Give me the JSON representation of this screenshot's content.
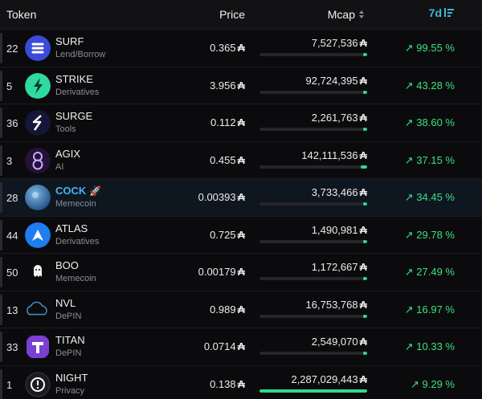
{
  "header": {
    "token": "Token",
    "price": "Price",
    "mcap": "Mcap",
    "period": "7d"
  },
  "currency_symbol": "₳",
  "rows": [
    {
      "rank": "22",
      "name": "SURF",
      "category": "Lend/Borrow",
      "price": "0.365",
      "mcap": "7,527,536",
      "mcap_fraction": 0.004,
      "change": "↗ 99.55 %",
      "logo_icon": "surf-logo-icon",
      "logo_bg": "#3a4bd8"
    },
    {
      "rank": "5",
      "name": "STRIKE",
      "category": "Derivatives",
      "price": "3.956",
      "mcap": "92,724,395",
      "mcap_fraction": 0.04,
      "change": "↗ 43.28 %",
      "logo_icon": "strike-logo-icon",
      "logo_bg": "#2fd9a0"
    },
    {
      "rank": "36",
      "name": "SURGE",
      "category": "Tools",
      "price": "0.112",
      "mcap": "2,261,763",
      "mcap_fraction": 0.001,
      "change": "↗ 38.60 %",
      "logo_icon": "surge-logo-icon",
      "logo_bg": "#1a1a3a"
    },
    {
      "rank": "3",
      "name": "AGIX",
      "category": "AI",
      "price": "0.455",
      "mcap": "142,111,536",
      "mcap_fraction": 0.062,
      "change": "↗ 37.15 %",
      "logo_icon": "agix-logo-icon",
      "logo_bg": "#2a1446"
    },
    {
      "rank": "28",
      "name": "COCK",
      "category": "Memecoin",
      "price": "0.00393",
      "mcap": "3,733,466",
      "mcap_fraction": 0.002,
      "change": "↗ 34.45 %",
      "logo_icon": "cock-logo-icon",
      "logo_bg": "#3a6fa8",
      "highlight": true
    },
    {
      "rank": "44",
      "name": "ATLAS",
      "category": "Derivatives",
      "price": "0.725",
      "mcap": "1,490,981",
      "mcap_fraction": 0.001,
      "change": "↗ 29.78 %",
      "logo_icon": "atlas-logo-icon",
      "logo_bg": "#1e7df0"
    },
    {
      "rank": "50",
      "name": "BOO",
      "category": "Memecoin",
      "price": "0.00179",
      "mcap": "1,172,667",
      "mcap_fraction": 0.0005,
      "change": "↗ 27.49 %",
      "logo_icon": "boo-logo-icon",
      "logo_bg": "#0b0b0d"
    },
    {
      "rank": "13",
      "name": "NVL",
      "category": "DePIN",
      "price": "0.989",
      "mcap": "16,753,768",
      "mcap_fraction": 0.007,
      "change": "↗ 16.97 %",
      "logo_icon": "nvl-logo-icon",
      "logo_bg": "#0b0b0d"
    },
    {
      "rank": "33",
      "name": "TITAN",
      "category": "DePIN",
      "price": "0.0714",
      "mcap": "2,549,070",
      "mcap_fraction": 0.001,
      "change": "↗ 10.33 %",
      "logo_icon": "titan-logo-icon",
      "logo_bg": "#7b3fd1"
    },
    {
      "rank": "1",
      "name": "NIGHT",
      "category": "Privacy",
      "price": "0.138",
      "mcap": "2,287,029,443",
      "mcap_fraction": 1.0,
      "change": "↗ 9.29 %",
      "logo_icon": "night-logo-icon",
      "logo_bg": "#1c1c1f"
    }
  ]
}
